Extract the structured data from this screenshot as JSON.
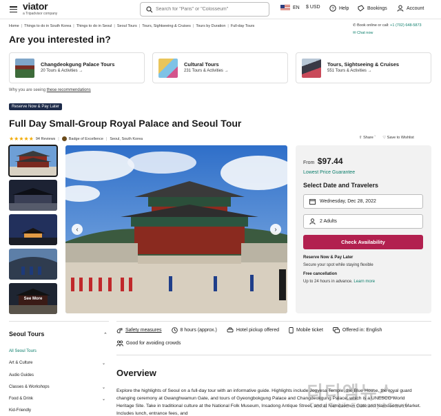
{
  "header": {
    "brand": "viator",
    "brand_sub": "a Tripadvisor company",
    "search_placeholder": "Search for \"Paris\" or \"Colosseum\"",
    "language": "EN",
    "currency": "$ USD",
    "help": "Help",
    "bookings": "Bookings",
    "account": "Account"
  },
  "breadcrumb": [
    "Home",
    "Things to do in South Korea",
    "Things to do in Seoul",
    "Seoul Tours",
    "Tours, Sightseeing & Cruises",
    "Tours by Duration",
    "Full-day Tours"
  ],
  "contact": {
    "book_label": "Book online or call:",
    "phone": "+1 (702) 648-5873",
    "chat": "Chat now"
  },
  "interest": {
    "heading": "Are you interested in?",
    "cards": [
      {
        "title": "Changdeokgung Palace Tours",
        "count": "20 Tours & Activities →"
      },
      {
        "title": "Cultural Tours",
        "count": "231 Tours & Activities →"
      },
      {
        "title": "Tours, Sightseeing & Cruises",
        "count": "551 Tours & Activities →"
      }
    ],
    "why_text": "Why you are seeing",
    "why_link": "these recommendations"
  },
  "product": {
    "badge": "Reserve Now & Pay Later",
    "title": "Full Day Small-Group Royal Palace and Seoul Tour",
    "stars": "★★★★★",
    "reviews": "94 Reviews",
    "excellence": "Badge of Excellence",
    "location": "Seoul, South Korea",
    "share": "Share",
    "wishlist": "Save to Wishlist",
    "see_more": "See More"
  },
  "booking": {
    "from": "From",
    "price": "$97.44",
    "guarantee": "Lowest Price Guarantee",
    "select_heading": "Select Date and Travelers",
    "date": "Wednesday, Dec 28, 2022",
    "travelers": "2 Adults",
    "cta": "Check Availability",
    "rnpl_title": "Reserve Now & Pay Later",
    "rnpl_text": "Secure your spot while staying flexible",
    "cancel_title": "Free cancellation",
    "cancel_text": "Up to 24 hours in advance.",
    "learn_more": "Learn more"
  },
  "sidebar": {
    "title": "Seoul Tours",
    "items": [
      {
        "label": "All Seoul Tours",
        "expandable": false
      },
      {
        "label": "Art & Culture",
        "expandable": true
      },
      {
        "label": "Audio Guides",
        "expandable": false
      },
      {
        "label": "Classes & Workshops",
        "expandable": true
      },
      {
        "label": "Food & Drink",
        "expandable": true
      },
      {
        "label": "Kid-Friendly",
        "expandable": false
      }
    ]
  },
  "features": {
    "safety": "Safety measures",
    "duration": "8 hours (approx.)",
    "pickup": "Hotel pickup offered",
    "ticket": "Mobile ticket",
    "language": "Offered in: English",
    "crowds": "Good for avoiding crowds"
  },
  "overview": {
    "heading": "Overview",
    "text": "Explore the highlights of Seoul on a full-day tour with an informative guide. Highlights include Jogyesa Temple, the Blue House, the royal guard changing ceremony at Gwanghwamun Gate, and tours of Gyeongbokgung Palace and Changdeokgung Palace, which is a UNESCO World Heritage Site. Take in traditional culture at the National Folk Museum, Insadong Antique Street, and at Namdaemun Gate and Namdaemun Market. Includes lunch, entrance fees, and"
  },
  "watermark": {
    "line1": "티티엠뉴스",
    "line2": "Trend To Life Economy & Travel"
  },
  "colors": {
    "accent_green": "#0a7d6a",
    "cta": "#b2204f",
    "badge_bg": "#1d2b4a",
    "star": "#f2a900"
  }
}
